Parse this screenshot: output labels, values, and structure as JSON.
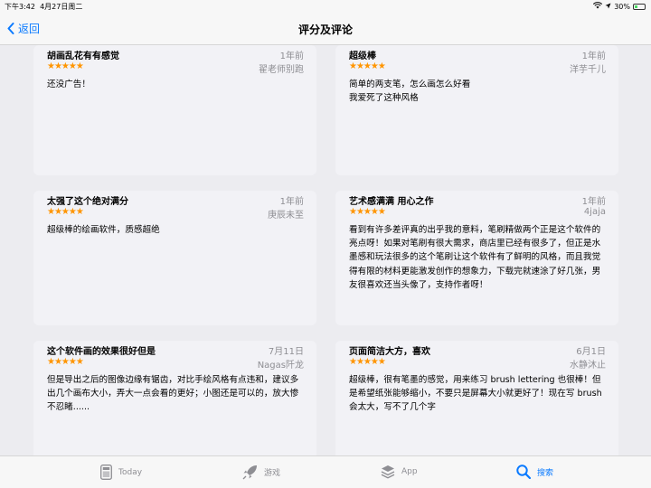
{
  "status_bar": {
    "time": "下午3:42",
    "date": "4月27日周二",
    "battery": "30%",
    "battery_level": 0.3
  },
  "nav": {
    "back_label": "返回",
    "title": "评分及评论"
  },
  "reviews": [
    {
      "title": "胡画乱花有有感觉",
      "date": "1年前",
      "stars": "★★★★★",
      "author": "翟老师别跑",
      "body": "还没广告！"
    },
    {
      "title": "超级棒",
      "date": "1年前",
      "stars": "★★★★★",
      "author": "洋芋千儿",
      "body": "简单的两支笔，怎么画怎么好看\n我爱死了这种风格"
    },
    {
      "title": "太强了这个绝对满分",
      "date": "1年前",
      "stars": "★★★★★",
      "author": "庚辰未至",
      "body": "超级棒的绘画软件，质感超绝"
    },
    {
      "title": "艺术感满满 用心之作",
      "date": "1年前",
      "stars": "★★★★★",
      "author": "4jaja",
      "body": "看到有许多差评真的出乎我的意料，笔刷精做两个正是这个软件的亮点呀！如果对笔刷有很大需求，商店里已经有很多了，但正是水墨感和玩法很多的这个笔刷让这个软件有了鲜明的风格，而且我觉得有限的材料更能激发创作的想象力，下载完就速涂了好几张，男友很喜欢还当头像了，支持作者呀！"
    },
    {
      "title": "这个软件画的效果很好但是",
      "date": "7月11日",
      "stars": "★★★★★",
      "author": "Nagas阡龙",
      "body": "但是导出之后的图像边缘有锯齿，对比手绘风格有点违和，建议多出几个画布大小，弄大一点会看的更好；小图还是可以的，放大惨不忍睹......"
    },
    {
      "title": "页面简洁大方，喜欢",
      "date": "6月1日",
      "stars": "★★★★★",
      "author": "水静沐止",
      "body": "超级棒，很有笔墨的感觉，用来练习 brush lettering 也很棒！但是希望纸张能够缩小，不要只是屏幕大小就更好了！现在写 brush 会太大，写不了几个字"
    }
  ],
  "tabs": [
    {
      "label": "Today",
      "icon": "today-icon",
      "active": false
    },
    {
      "label": "游戏",
      "icon": "rocket-icon",
      "active": false
    },
    {
      "label": "App",
      "icon": "apps-stack-icon",
      "active": false
    },
    {
      "label": "搜索",
      "icon": "search-icon",
      "active": true
    }
  ],
  "colors": {
    "accent": "#0a7aff",
    "stars": "#ff9500",
    "card_bg": "#f2f2f6",
    "secondary_text": "#8e8e93"
  }
}
